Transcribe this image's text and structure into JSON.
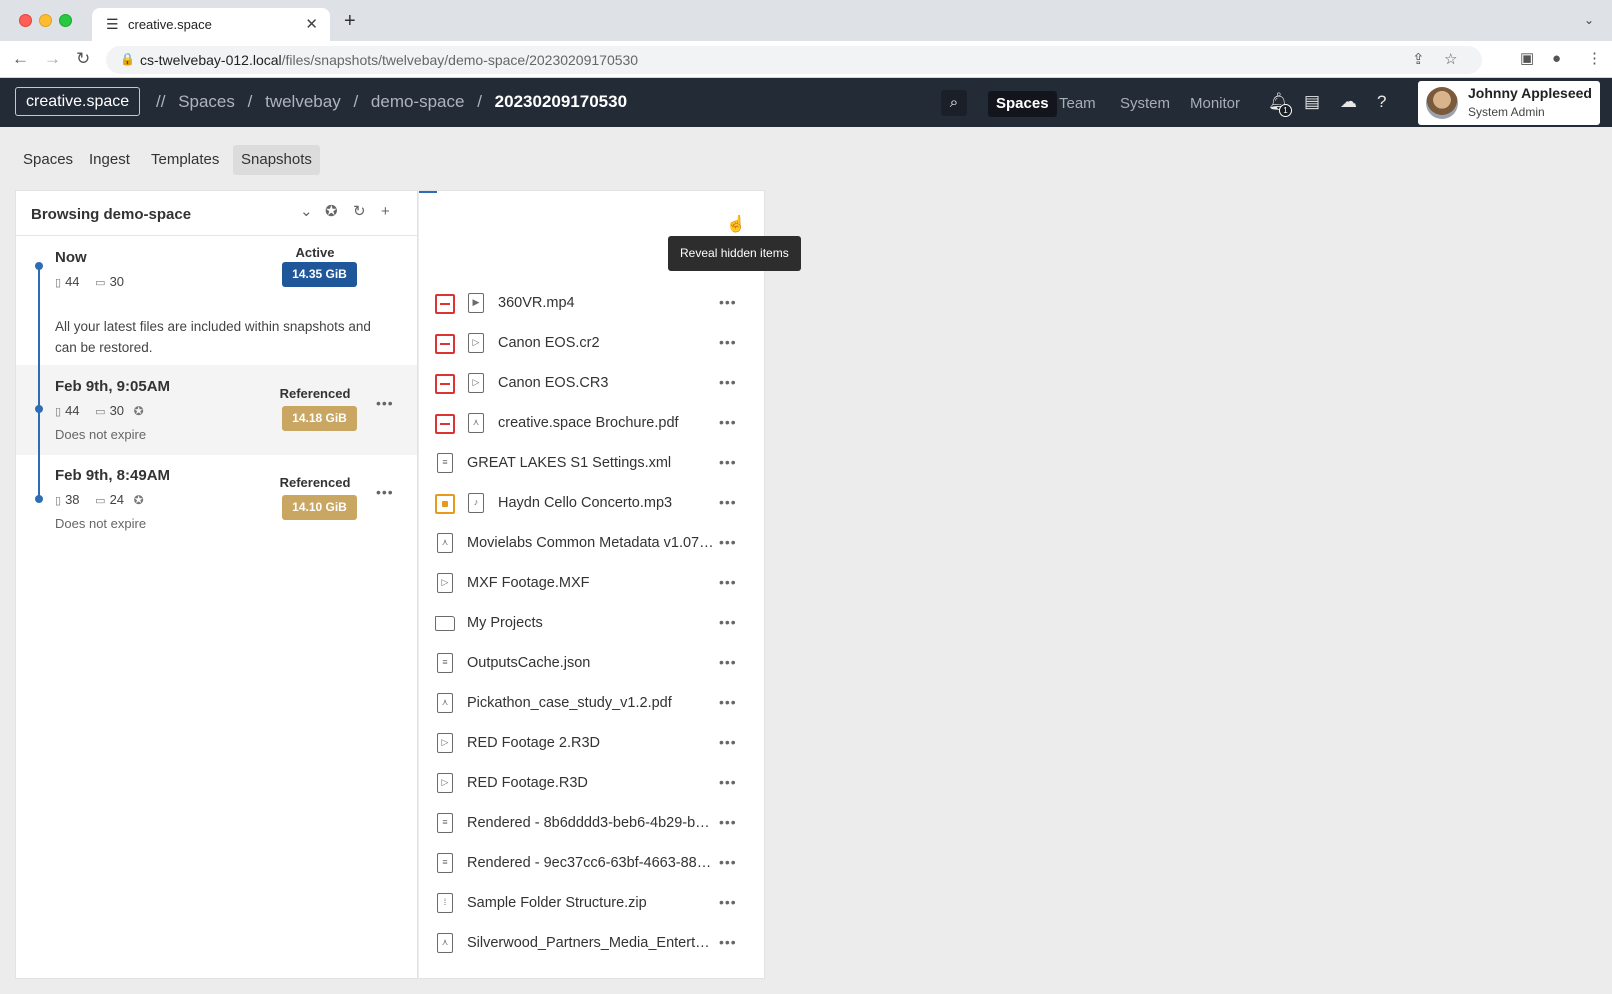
{
  "browser": {
    "tab_title": "creative.space",
    "url_host": "cs-twelvebay-012.local",
    "url_path": "/files/snapshots/twelvebay/demo-space/20230209170530"
  },
  "app": {
    "logo": "creative.space",
    "breadcrumb": {
      "prefix": "//",
      "items": [
        "Spaces",
        "twelvebay",
        "demo-space",
        "20230209170530"
      ],
      "separator": "/"
    },
    "nav": [
      "Spaces",
      "Team",
      "System",
      "Monitor"
    ],
    "notifications_count": "1",
    "user": {
      "name": "Johnny Appleseed",
      "role": "System Admin"
    }
  },
  "subnav": [
    "Spaces",
    "Ingest",
    "Templates",
    "Snapshots"
  ],
  "snapshots_panel": {
    "title": "Browsing demo-space",
    "items": [
      {
        "title": "Now",
        "files": "44",
        "folders": "30",
        "status": "Active",
        "size": "14.35 GiB",
        "description": "All your latest files are included within snapshots and can be restored."
      },
      {
        "title": "Feb 9th, 9:05AM",
        "files": "44",
        "folders": "30",
        "status": "Referenced",
        "size": "14.18 GiB",
        "note": "Does not expire"
      },
      {
        "title": "Feb 9th, 8:49AM",
        "files": "38",
        "folders": "24",
        "status": "Referenced",
        "size": "14.10 GiB",
        "note": "Does not expire"
      }
    ]
  },
  "tooltip": "Reveal hidden items",
  "files": [
    "360VR.mp4",
    "Canon EOS.cr2",
    "Canon EOS.CR3",
    "creative.space Brochure.pdf",
    "GREAT LAKES S1 Settings.xml",
    "Haydn Cello Concerto.mp3",
    "Movielabs Common Metadata v1.07....",
    "MXF Footage.MXF",
    "My Projects",
    "OutputsCache.json",
    "Pickathon_case_study_v1.2.pdf",
    "RED Footage 2.R3D",
    "RED Footage.R3D",
    "Rendered - 8b6dddd3-beb6-4b29-be...",
    "Rendered - 9ec37cc6-63bf-4663-88c4...",
    "Sample Folder Structure.zip",
    "Silverwood_Partners_Media_Entertai..."
  ],
  "icons": {
    "menu": "hamburger-icon",
    "search": "search-icon",
    "bell": "bell-icon",
    "folder": "folder-icon",
    "upload": "cloud-upload-icon",
    "help": "help-icon"
  },
  "colors": {
    "header_bg": "#232b36",
    "active_badge": "#20569a",
    "referenced_badge": "#c9a661",
    "removed": "#d33333",
    "modified": "#e89a1c"
  }
}
